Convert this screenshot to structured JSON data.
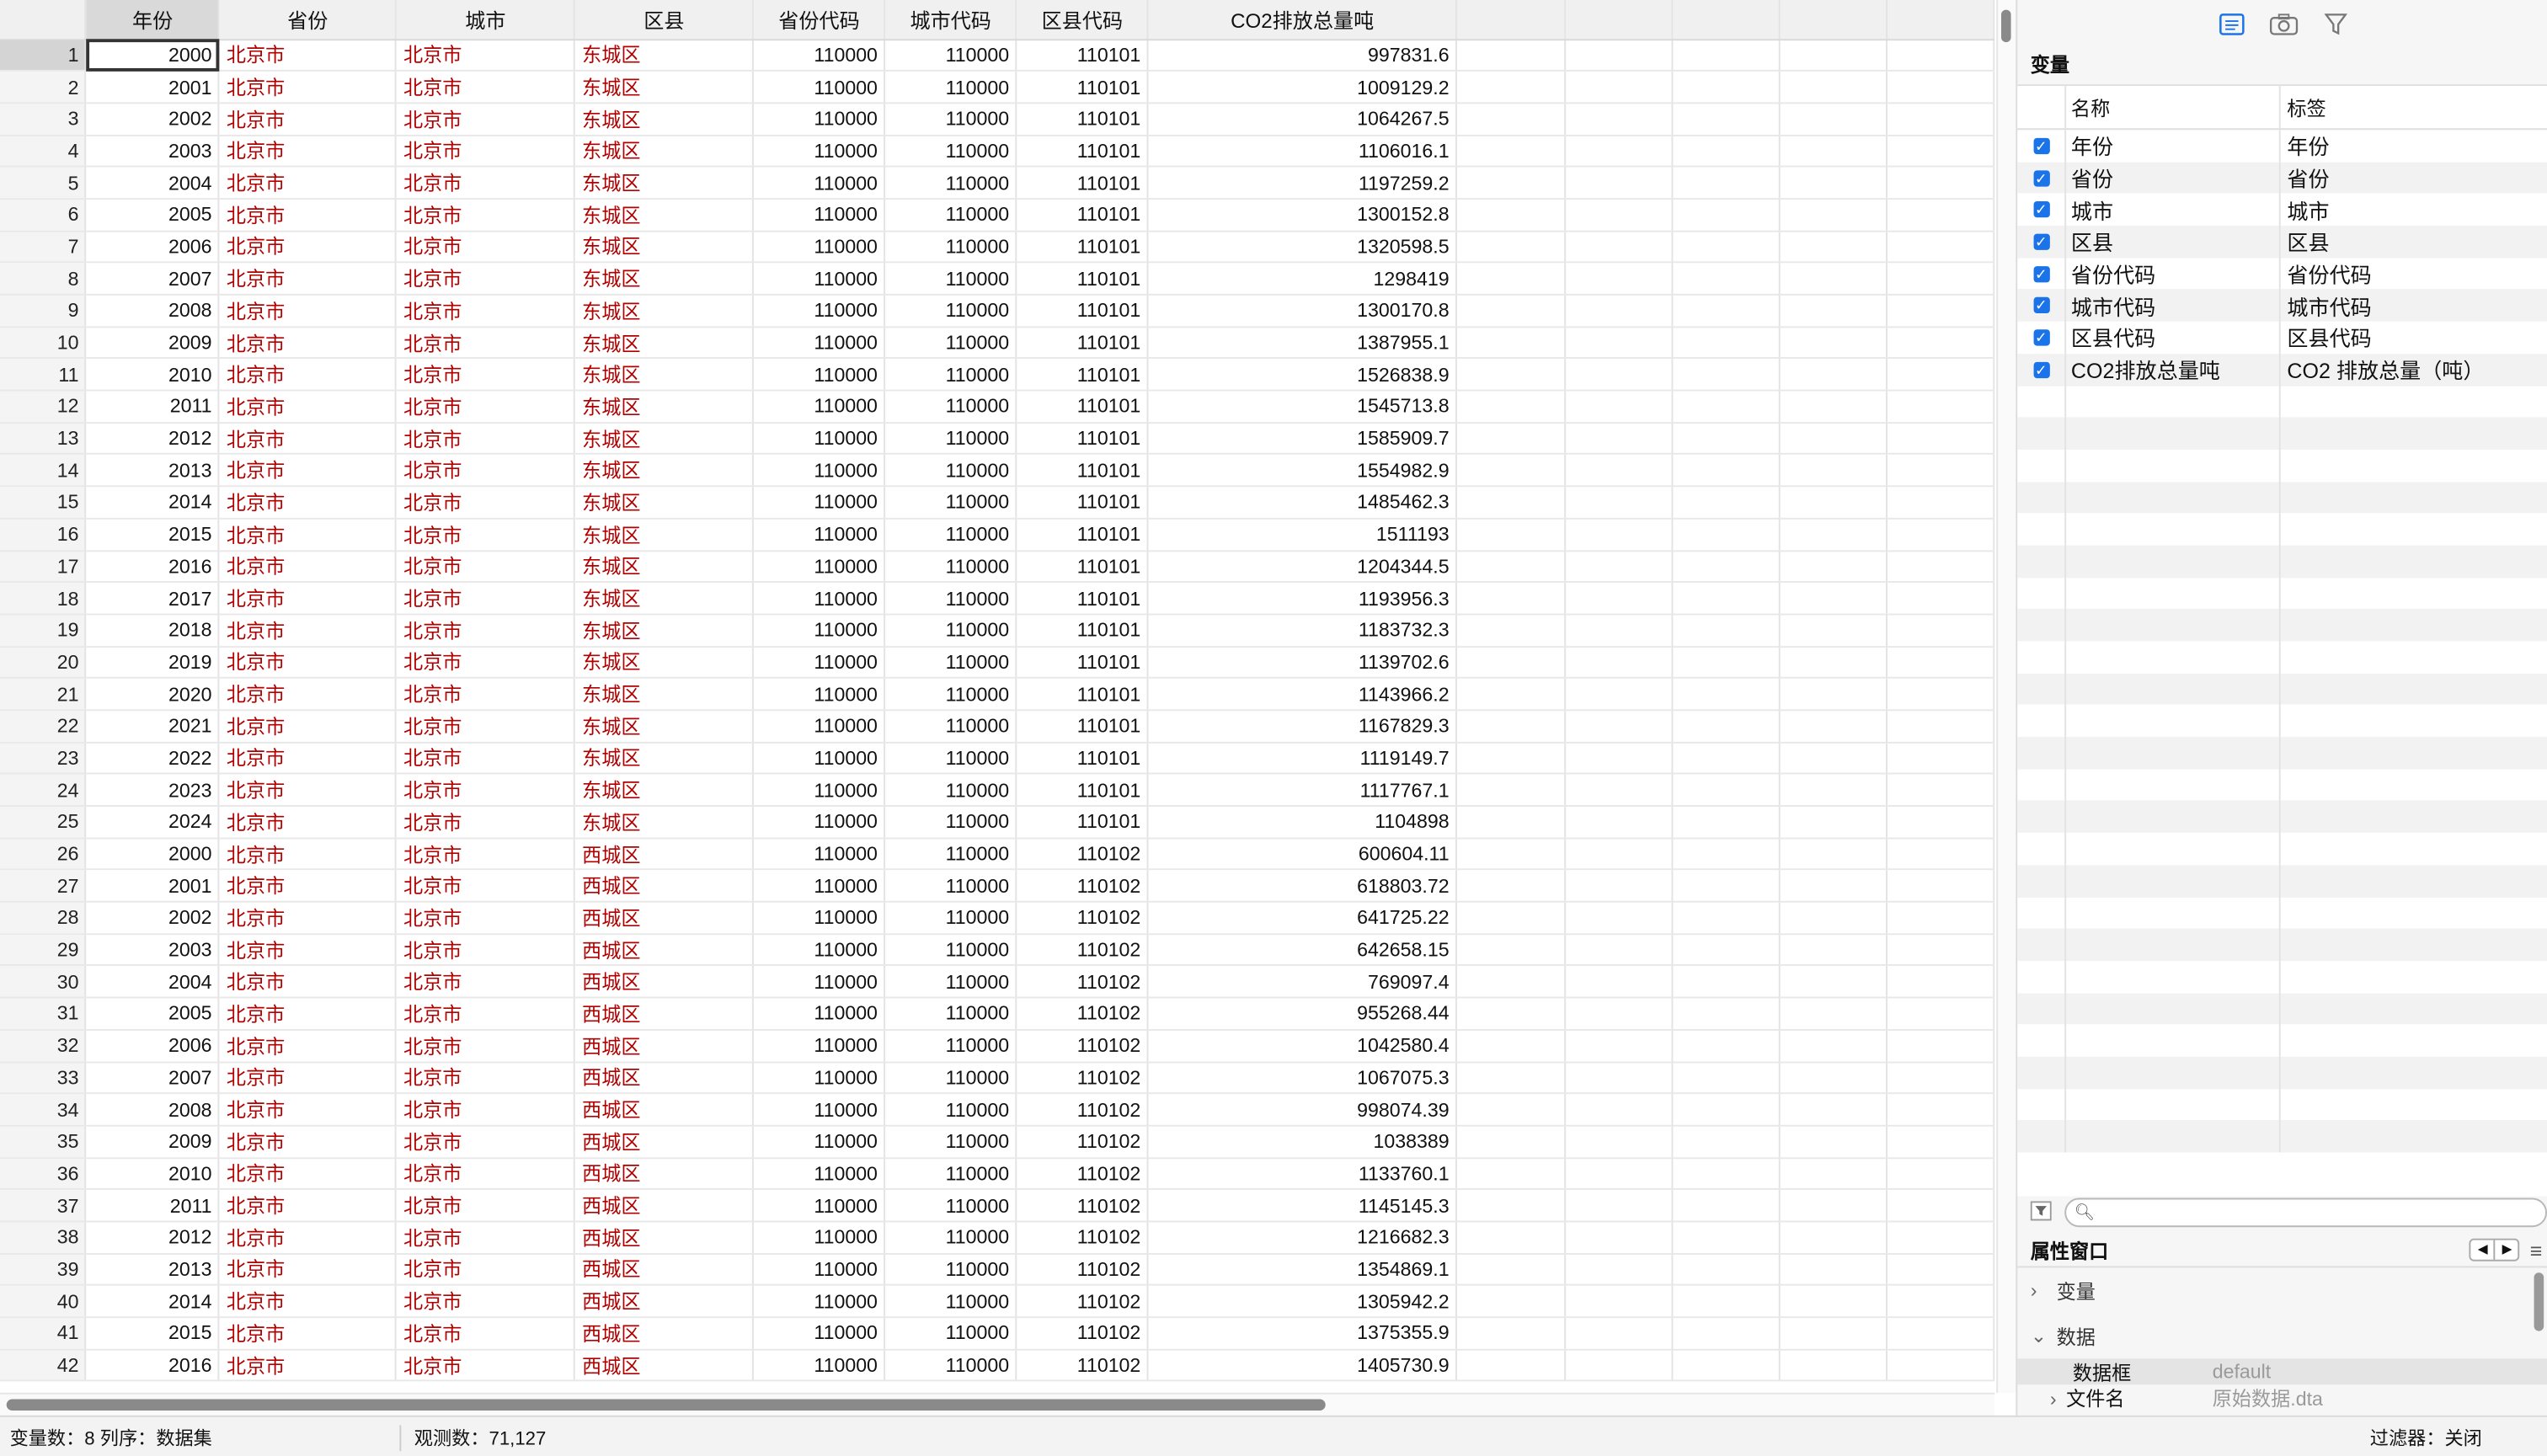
{
  "grid": {
    "columns": [
      "年份",
      "省份",
      "城市",
      "区县",
      "省份代码",
      "城市代码",
      "区县代码",
      "CO2排放总量吨"
    ],
    "rows": [
      [
        1,
        2000,
        "北京市",
        "北京市",
        "东城区",
        110000,
        110000,
        110101,
        "997831.6"
      ],
      [
        2,
        2001,
        "北京市",
        "北京市",
        "东城区",
        110000,
        110000,
        110101,
        "1009129.2"
      ],
      [
        3,
        2002,
        "北京市",
        "北京市",
        "东城区",
        110000,
        110000,
        110101,
        "1064267.5"
      ],
      [
        4,
        2003,
        "北京市",
        "北京市",
        "东城区",
        110000,
        110000,
        110101,
        "1106016.1"
      ],
      [
        5,
        2004,
        "北京市",
        "北京市",
        "东城区",
        110000,
        110000,
        110101,
        "1197259.2"
      ],
      [
        6,
        2005,
        "北京市",
        "北京市",
        "东城区",
        110000,
        110000,
        110101,
        "1300152.8"
      ],
      [
        7,
        2006,
        "北京市",
        "北京市",
        "东城区",
        110000,
        110000,
        110101,
        "1320598.5"
      ],
      [
        8,
        2007,
        "北京市",
        "北京市",
        "东城区",
        110000,
        110000,
        110101,
        "1298419"
      ],
      [
        9,
        2008,
        "北京市",
        "北京市",
        "东城区",
        110000,
        110000,
        110101,
        "1300170.8"
      ],
      [
        10,
        2009,
        "北京市",
        "北京市",
        "东城区",
        110000,
        110000,
        110101,
        "1387955.1"
      ],
      [
        11,
        2010,
        "北京市",
        "北京市",
        "东城区",
        110000,
        110000,
        110101,
        "1526838.9"
      ],
      [
        12,
        2011,
        "北京市",
        "北京市",
        "东城区",
        110000,
        110000,
        110101,
        "1545713.8"
      ],
      [
        13,
        2012,
        "北京市",
        "北京市",
        "东城区",
        110000,
        110000,
        110101,
        "1585909.7"
      ],
      [
        14,
        2013,
        "北京市",
        "北京市",
        "东城区",
        110000,
        110000,
        110101,
        "1554982.9"
      ],
      [
        15,
        2014,
        "北京市",
        "北京市",
        "东城区",
        110000,
        110000,
        110101,
        "1485462.3"
      ],
      [
        16,
        2015,
        "北京市",
        "北京市",
        "东城区",
        110000,
        110000,
        110101,
        "1511193"
      ],
      [
        17,
        2016,
        "北京市",
        "北京市",
        "东城区",
        110000,
        110000,
        110101,
        "1204344.5"
      ],
      [
        18,
        2017,
        "北京市",
        "北京市",
        "东城区",
        110000,
        110000,
        110101,
        "1193956.3"
      ],
      [
        19,
        2018,
        "北京市",
        "北京市",
        "东城区",
        110000,
        110000,
        110101,
        "1183732.3"
      ],
      [
        20,
        2019,
        "北京市",
        "北京市",
        "东城区",
        110000,
        110000,
        110101,
        "1139702.6"
      ],
      [
        21,
        2020,
        "北京市",
        "北京市",
        "东城区",
        110000,
        110000,
        110101,
        "1143966.2"
      ],
      [
        22,
        2021,
        "北京市",
        "北京市",
        "东城区",
        110000,
        110000,
        110101,
        "1167829.3"
      ],
      [
        23,
        2022,
        "北京市",
        "北京市",
        "东城区",
        110000,
        110000,
        110101,
        "1119149.7"
      ],
      [
        24,
        2023,
        "北京市",
        "北京市",
        "东城区",
        110000,
        110000,
        110101,
        "1117767.1"
      ],
      [
        25,
        2024,
        "北京市",
        "北京市",
        "东城区",
        110000,
        110000,
        110101,
        "1104898"
      ],
      [
        26,
        2000,
        "北京市",
        "北京市",
        "西城区",
        110000,
        110000,
        110102,
        "600604.11"
      ],
      [
        27,
        2001,
        "北京市",
        "北京市",
        "西城区",
        110000,
        110000,
        110102,
        "618803.72"
      ],
      [
        28,
        2002,
        "北京市",
        "北京市",
        "西城区",
        110000,
        110000,
        110102,
        "641725.22"
      ],
      [
        29,
        2003,
        "北京市",
        "北京市",
        "西城区",
        110000,
        110000,
        110102,
        "642658.15"
      ],
      [
        30,
        2004,
        "北京市",
        "北京市",
        "西城区",
        110000,
        110000,
        110102,
        "769097.4"
      ],
      [
        31,
        2005,
        "北京市",
        "北京市",
        "西城区",
        110000,
        110000,
        110102,
        "955268.44"
      ],
      [
        32,
        2006,
        "北京市",
        "北京市",
        "西城区",
        110000,
        110000,
        110102,
        "1042580.4"
      ],
      [
        33,
        2007,
        "北京市",
        "北京市",
        "西城区",
        110000,
        110000,
        110102,
        "1067075.3"
      ],
      [
        34,
        2008,
        "北京市",
        "北京市",
        "西城区",
        110000,
        110000,
        110102,
        "998074.39"
      ],
      [
        35,
        2009,
        "北京市",
        "北京市",
        "西城区",
        110000,
        110000,
        110102,
        "1038389"
      ],
      [
        36,
        2010,
        "北京市",
        "北京市",
        "西城区",
        110000,
        110000,
        110102,
        "1133760.1"
      ],
      [
        37,
        2011,
        "北京市",
        "北京市",
        "西城区",
        110000,
        110000,
        110102,
        "1145145.3"
      ],
      [
        38,
        2012,
        "北京市",
        "北京市",
        "西城区",
        110000,
        110000,
        110102,
        "1216682.3"
      ],
      [
        39,
        2013,
        "北京市",
        "北京市",
        "西城区",
        110000,
        110000,
        110102,
        "1354869.1"
      ],
      [
        40,
        2014,
        "北京市",
        "北京市",
        "西城区",
        110000,
        110000,
        110102,
        "1305942.2"
      ],
      [
        41,
        2015,
        "北京市",
        "北京市",
        "西城区",
        110000,
        110000,
        110102,
        "1375355.9"
      ],
      [
        42,
        2016,
        "北京市",
        "北京市",
        "西城区",
        110000,
        110000,
        110102,
        "1405730.9"
      ]
    ]
  },
  "right_panel": {
    "variables_title": "变量",
    "col_name": "名称",
    "col_label": "标签",
    "variables": [
      {
        "name": "年份",
        "label": "年份"
      },
      {
        "name": "省份",
        "label": "省份"
      },
      {
        "name": "城市",
        "label": "城市"
      },
      {
        "name": "区县",
        "label": "区县"
      },
      {
        "name": "省份代码",
        "label": "省份代码"
      },
      {
        "name": "城市代码",
        "label": "城市代码"
      },
      {
        "name": "区县代码",
        "label": "区县代码"
      },
      {
        "name": "CO2排放总量吨",
        "label": "CO2 排放总量（吨）"
      }
    ],
    "properties_title": "属性窗口",
    "tree_variable": "变量",
    "tree_data": "数据",
    "prop_frame_key": "数据框",
    "prop_frame_val": "default",
    "prop_file_key": "文件名",
    "prop_file_val": "原始数据.dta",
    "icons": [
      "variables-icon",
      "snapshot-camera-icon",
      "filter-icon"
    ]
  },
  "status": {
    "vars": "变量数：8  列序：数据集",
    "obs": "观测数：71,127",
    "filter": "过滤器：关闭"
  }
}
